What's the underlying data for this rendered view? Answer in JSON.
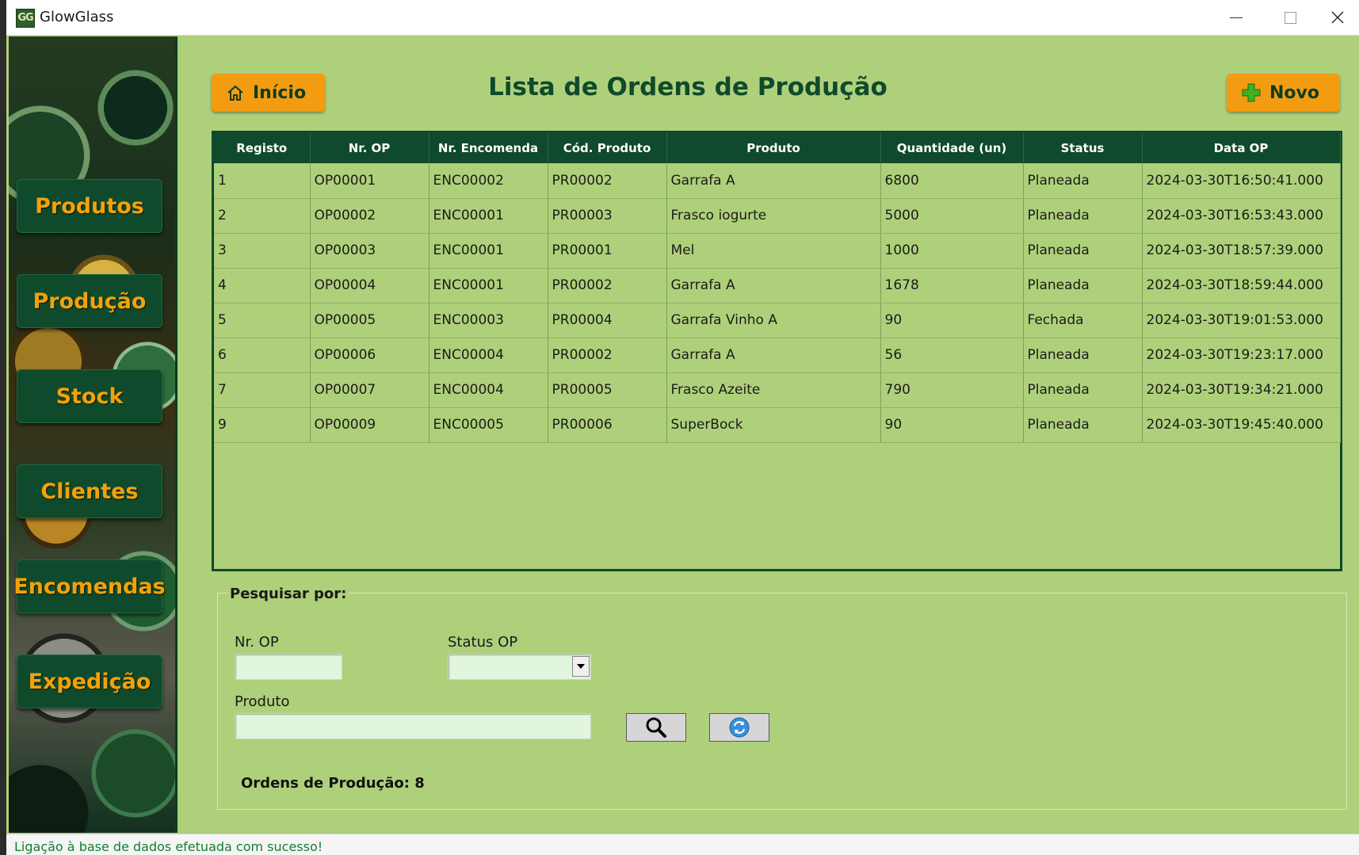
{
  "window": {
    "title": "GlowGlass",
    "icon_label": "GG"
  },
  "sidebar": {
    "items": [
      {
        "label": "Produtos"
      },
      {
        "label": "Produção"
      },
      {
        "label": "Stock"
      },
      {
        "label": "Clientes"
      },
      {
        "label": "Encomendas"
      },
      {
        "label": "Expedição"
      }
    ]
  },
  "header": {
    "home_label": "Início",
    "title": "Lista de Ordens de Produção",
    "new_label": "Novo"
  },
  "table": {
    "columns": [
      "Registo",
      "Nr. OP",
      "Nr. Encomenda",
      "Cód. Produto",
      "Produto",
      "Quantidade (un)",
      "Status",
      "Data OP"
    ],
    "rows": [
      [
        "1",
        "OP00001",
        "ENC00002",
        "PR00002",
        "Garrafa A",
        "6800",
        "Planeada",
        "2024-03-30T16:50:41.000"
      ],
      [
        "2",
        "OP00002",
        "ENC00001",
        "PR00003",
        "Frasco iogurte",
        "5000",
        "Planeada",
        "2024-03-30T16:53:43.000"
      ],
      [
        "3",
        "OP00003",
        "ENC00001",
        "PR00001",
        "Mel",
        "1000",
        "Planeada",
        "2024-03-30T18:57:39.000"
      ],
      [
        "4",
        "OP00004",
        "ENC00001",
        "PR00002",
        "Garrafa A",
        "1678",
        "Planeada",
        "2024-03-30T18:59:44.000"
      ],
      [
        "5",
        "OP00005",
        "ENC00003",
        "PR00004",
        "Garrafa Vinho A",
        "90",
        "Fechada",
        "2024-03-30T19:01:53.000"
      ],
      [
        "6",
        "OP00006",
        "ENC00004",
        "PR00002",
        "Garrafa A",
        "56",
        "Planeada",
        "2024-03-30T19:23:17.000"
      ],
      [
        "7",
        "OP00007",
        "ENC00004",
        "PR00005",
        "Frasco Azeite",
        "790",
        "Planeada",
        "2024-03-30T19:34:21.000"
      ],
      [
        "9",
        "OP00009",
        "ENC00005",
        "PR00006",
        "SuperBock",
        "90",
        "Planeada",
        "2024-03-30T19:45:40.000"
      ]
    ]
  },
  "search": {
    "legend": "Pesquisar por:",
    "op_label": "Nr. OP",
    "op_value": "",
    "status_label": "Status OP",
    "status_value": "",
    "product_label": "Produto",
    "product_value": "",
    "search_icon": "search-icon",
    "refresh_icon": "refresh-icon"
  },
  "summary": {
    "count_text": "Ordens de Produção: 8"
  },
  "statusbar": {
    "message": "Ligação à base de dados efetuada com sucesso!"
  },
  "colors": {
    "background": "#afd07a",
    "dark_green": "#0f4a2c",
    "orange": "#f39c12",
    "status_text": "#138030"
  }
}
